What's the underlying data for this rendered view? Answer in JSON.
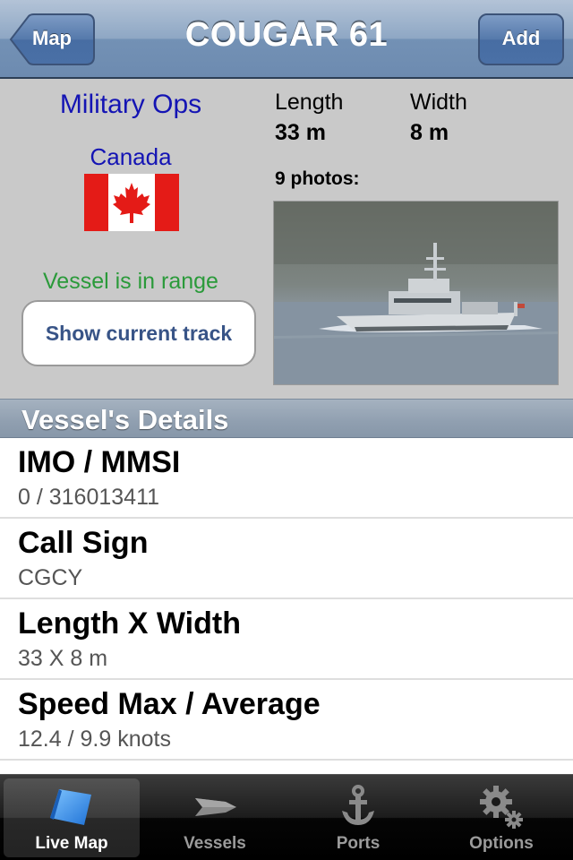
{
  "nav": {
    "title": "COUGAR 61",
    "back_label": "Map",
    "add_label": "Add"
  },
  "vessel": {
    "category": "Military Ops",
    "country": "Canada",
    "range_status": "Vessel is in range",
    "track_button": "Show current track",
    "length_label": "Length",
    "length_value": "33 m",
    "width_label": "Width",
    "width_value": "8 m",
    "photos_label": "9 photos:"
  },
  "details": {
    "header": "Vessel's Details",
    "rows": [
      {
        "title": "IMO / MMSI",
        "value": "0 / 316013411"
      },
      {
        "title": "Call Sign",
        "value": "CGCY"
      },
      {
        "title": "Length X Width",
        "value": "33 X 8 m"
      },
      {
        "title": "Speed Max / Average",
        "value": "12.4 / 9.9 knots"
      }
    ]
  },
  "tabs": [
    {
      "label": "Live Map",
      "icon": "live-map-icon",
      "active": true
    },
    {
      "label": "Vessels",
      "icon": "vessel-icon",
      "active": false
    },
    {
      "label": "Ports",
      "icon": "anchor-icon",
      "active": false
    },
    {
      "label": "Options",
      "icon": "gear-icon",
      "active": false
    }
  ],
  "colors": {
    "link_blue": "#1414b4",
    "in_range_green": "#2a9a3a",
    "button_text": "#385487"
  }
}
